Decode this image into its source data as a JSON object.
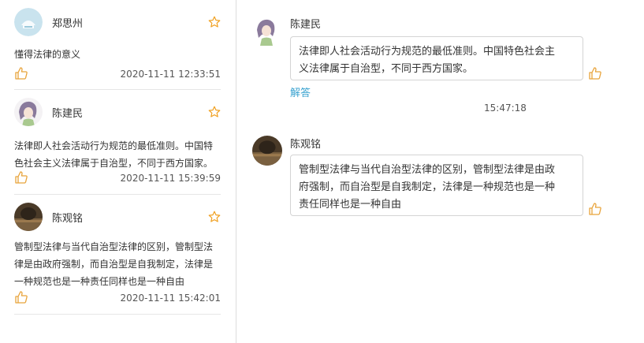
{
  "comments": [
    {
      "name": "郑思州",
      "text": "懂得法律的意义",
      "time": "2020-11-11 12:33:51",
      "avatar": "logo-avatar-icon"
    },
    {
      "name": "陈建民",
      "text_lines": [
        "法律即人社会活动行为规范的最低准则。中国特",
        "色社会主义法律属于自治型，不同于西方国家。"
      ],
      "time": "2020-11-11 15:39:59",
      "avatar": "anime-girl-avatar-icon"
    },
    {
      "name": "陈观铭",
      "text_lines": [
        "管制型法律与当代自治型法律的区别，管制型法",
        "律是由政府强制，而自治型是自我制定，法律是",
        "一种规范也是一种责任同样也是一种自由"
      ],
      "time": "2020-11-11 15:42:01",
      "avatar": "dark-photo-avatar-icon"
    }
  ],
  "chat": [
    {
      "name": "陈建民",
      "text_lines": [
        "法律即人社会活动行为规范的最低准则。中国特色社会主",
        "义法律属于自治型，不同于西方国家。"
      ],
      "reply_label": "解答",
      "time": "15:47:18"
    },
    {
      "name": "陈观铭",
      "text_lines": [
        "管制型法律与当代自治型法律的区别，管制型法律是由政",
        "府强制，而自治型是自我制定，法律是一种规范也是一种",
        "责任同样也是一种自由"
      ]
    }
  ],
  "colors": {
    "accent_star": "#f0a020",
    "like_icon": "#e8a33a",
    "reply_link": "#3ba3d0"
  }
}
